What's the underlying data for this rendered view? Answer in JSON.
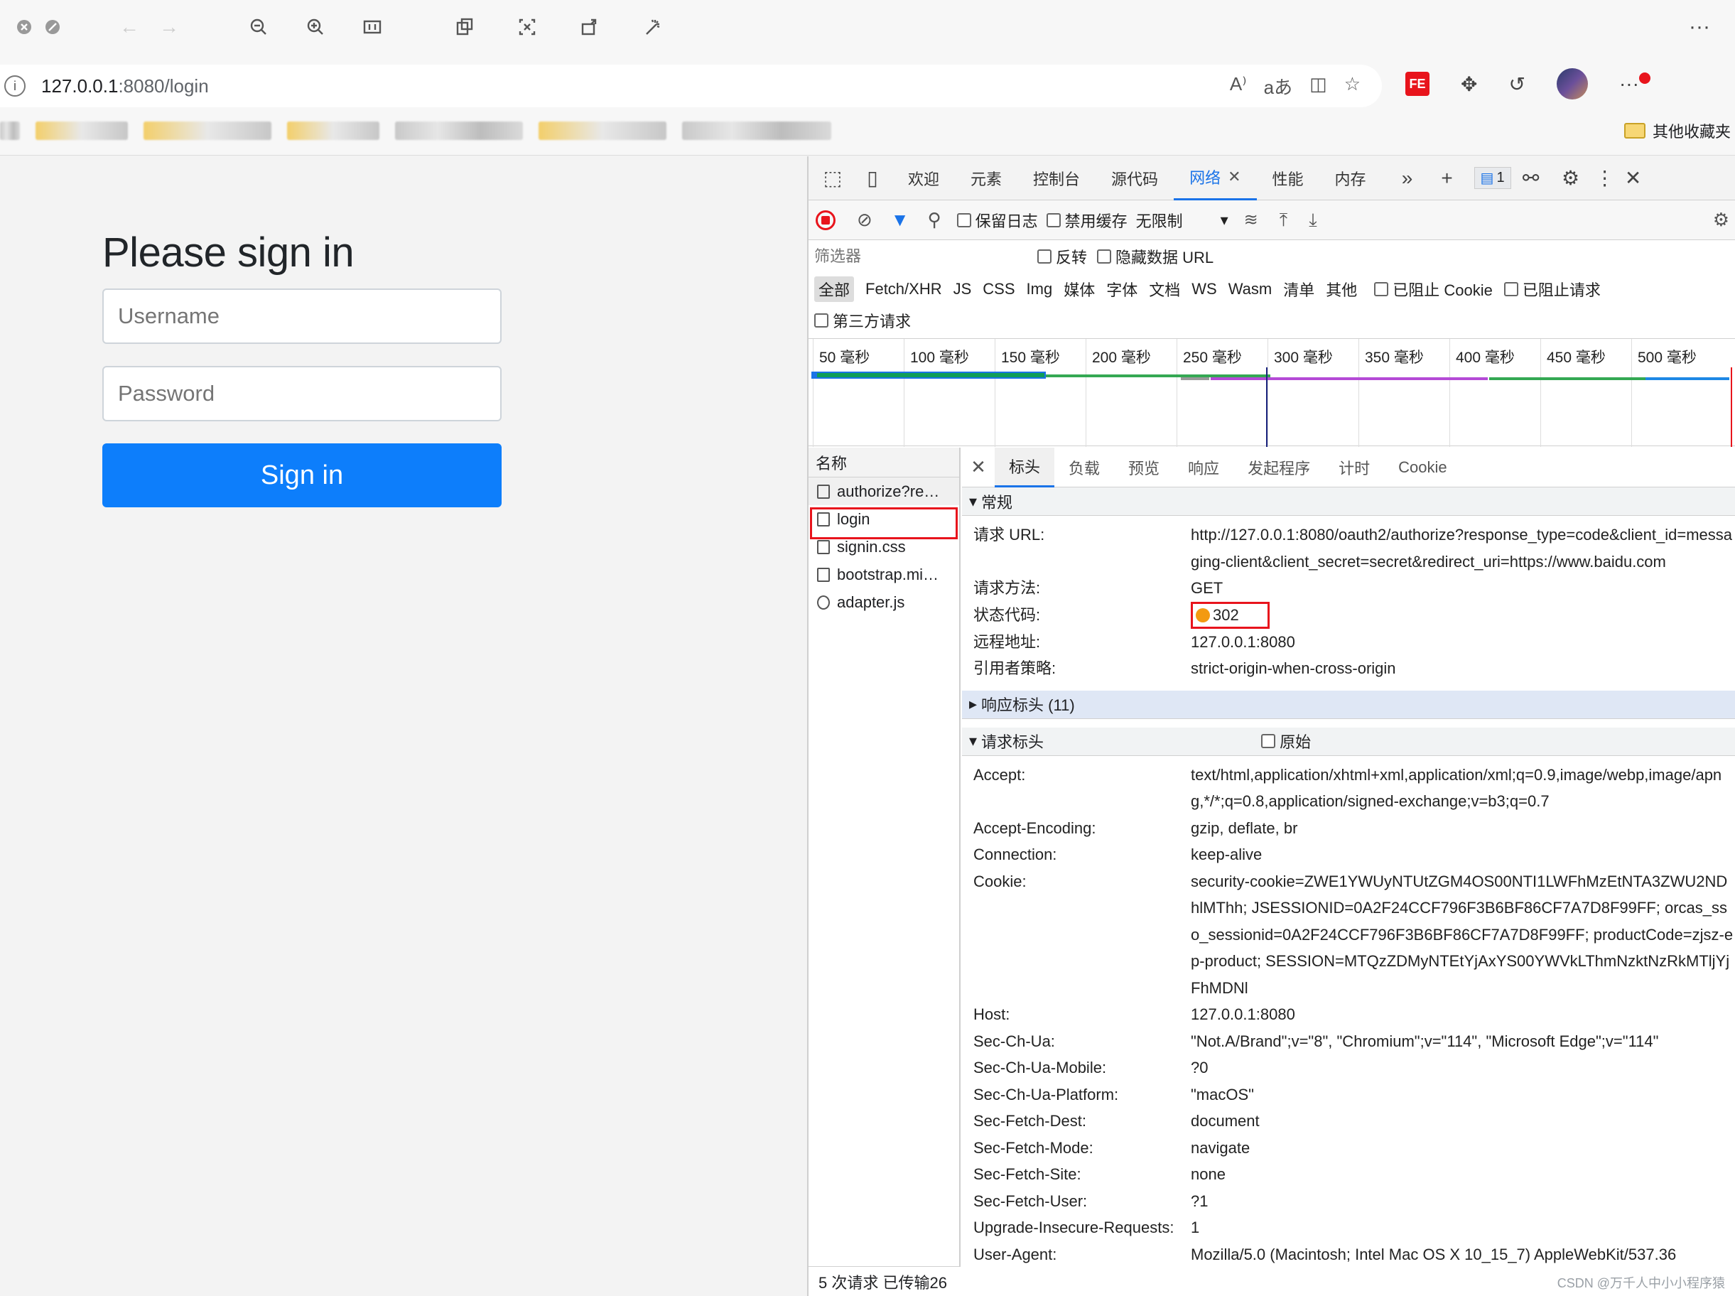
{
  "browser": {
    "url_host": "127.0.0.1",
    "url_path": ":8080/login",
    "favorites_folder": "其他收藏夹"
  },
  "page": {
    "heading": "Please sign in",
    "username_placeholder": "Username",
    "password_placeholder": "Password",
    "signin_label": "Sign in"
  },
  "devtools": {
    "tabs": [
      "欢迎",
      "元素",
      "控制台",
      "源代码",
      "网络",
      "性能",
      "内存"
    ],
    "active_tab": "网络",
    "issues_count": "1",
    "toolbar": {
      "preserve_log": "保留日志",
      "disable_cache": "禁用缓存",
      "throttle": "无限制"
    },
    "filter": {
      "placeholder": "筛选器",
      "invert": "反转",
      "hide_data_url": "隐藏数据 URL",
      "types": [
        "全部",
        "Fetch/XHR",
        "JS",
        "CSS",
        "Img",
        "媒体",
        "字体",
        "文档",
        "WS",
        "Wasm",
        "清单",
        "其他"
      ],
      "blocked_cookie": "已阻止 Cookie",
      "blocked_requests": "已阻止请求",
      "third_party": "第三方请求"
    },
    "timeline_ticks": [
      "50 毫秒",
      "100 毫秒",
      "150 毫秒",
      "200 毫秒",
      "250 毫秒",
      "300 毫秒",
      "350 毫秒",
      "400 毫秒",
      "450 毫秒",
      "500 毫秒"
    ],
    "name_header": "名称",
    "requests": [
      {
        "name": "authorize?re…",
        "icon": "document-icon"
      },
      {
        "name": "login",
        "icon": "document-icon"
      },
      {
        "name": "signin.css",
        "icon": "stylesheet-icon"
      },
      {
        "name": "bootstrap.mi…",
        "icon": "stylesheet-icon"
      },
      {
        "name": "adapter.js",
        "icon": "script-icon"
      }
    ],
    "footer": "5 次请求  已传输26",
    "detail_tabs": [
      "标头",
      "负载",
      "预览",
      "响应",
      "发起程序",
      "计时",
      "Cookie"
    ],
    "general": {
      "title": "常规",
      "rows": [
        {
          "k": "请求 URL:",
          "v": "http://127.0.0.1:8080/oauth2/authorize?response_type=code&client_id=messaging-client&client_secret=secret&redirect_uri=https://www.baidu.com"
        },
        {
          "k": "请求方法:",
          "v": "GET"
        },
        {
          "k": "状态代码:",
          "v": "302"
        },
        {
          "k": "远程地址:",
          "v": "127.0.0.1:8080"
        },
        {
          "k": "引用者策略:",
          "v": "strict-origin-when-cross-origin"
        }
      ]
    },
    "response_headers": "响应标头 (11)",
    "request_headers": {
      "title": "请求标头",
      "raw": "原始",
      "rows": [
        {
          "k": "Accept:",
          "v": "text/html,application/xhtml+xml,application/xml;q=0.9,image/webp,image/apng,*/*;q=0.8,application/signed-exchange;v=b3;q=0.7"
        },
        {
          "k": "Accept-Encoding:",
          "v": "gzip, deflate, br"
        },
        {
          "k": "Connection:",
          "v": "keep-alive"
        },
        {
          "k": "Cookie:",
          "v": "security-cookie=ZWE1YWUyNTUtZGM4OS00NTI1LWFhMzEtNTA3ZWU2NDhlMThh; JSESSIONID=0A2F24CCF796F3B6BF86CF7A7D8F99FF; orcas_sso_sessionid=0A2F24CCF796F3B6BF86CF7A7D8F99FF; productCode=zjsz-ep-product; SESSION=MTQzZDMyNTEtYjAxYS00YWVkLThmNzktNzRkMTljYjFhMDNl"
        },
        {
          "k": "Host:",
          "v": "127.0.0.1:8080"
        },
        {
          "k": "Sec-Ch-Ua:",
          "v": "\"Not.A/Brand\";v=\"8\", \"Chromium\";v=\"114\", \"Microsoft Edge\";v=\"114\""
        },
        {
          "k": "Sec-Ch-Ua-Mobile:",
          "v": "?0"
        },
        {
          "k": "Sec-Ch-Ua-Platform:",
          "v": "\"macOS\""
        },
        {
          "k": "Sec-Fetch-Dest:",
          "v": "document"
        },
        {
          "k": "Sec-Fetch-Mode:",
          "v": "navigate"
        },
        {
          "k": "Sec-Fetch-Site:",
          "v": "none"
        },
        {
          "k": "Sec-Fetch-User:",
          "v": "?1"
        },
        {
          "k": "Upgrade-Insecure-Requests:",
          "v": "1"
        },
        {
          "k": "User-Agent:",
          "v": "Mozilla/5.0 (Macintosh; Intel Mac OS X 10_15_7) AppleWebKit/537.36"
        }
      ]
    }
  },
  "watermark": "CSDN @万千人中小小程序猿",
  "colors": {
    "signin_button": "#0d7efb",
    "status_302": "#f39a11",
    "highlight_box": "#e8141c"
  }
}
